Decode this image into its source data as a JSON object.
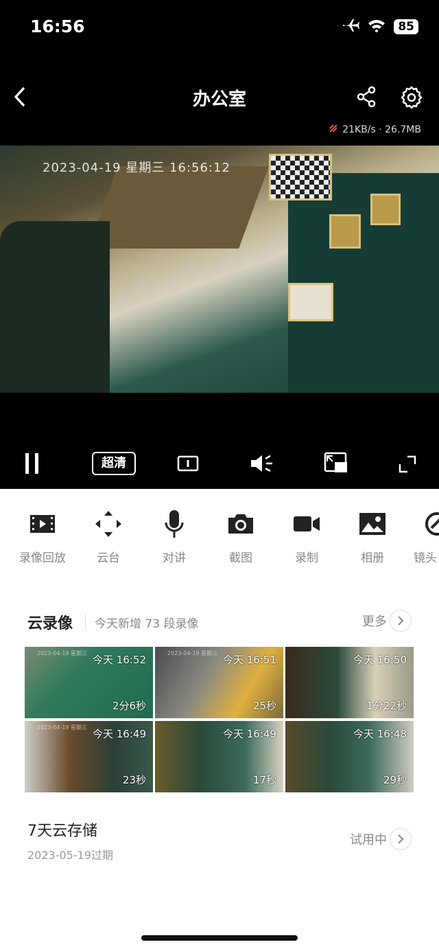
{
  "status": {
    "time": "16:56",
    "battery": "85"
  },
  "nav": {
    "title": "办公室"
  },
  "stream": {
    "speed": "21KB/s · 26.7MB"
  },
  "video": {
    "timestamp": "2023-04-19 星期三 16:56:12"
  },
  "controls": {
    "quality": "超清"
  },
  "toolbar": {
    "items": [
      {
        "label": "录像回放",
        "icon": "film-icon"
      },
      {
        "label": "云台",
        "icon": "ptz-arrows-icon"
      },
      {
        "label": "对讲",
        "icon": "microphone-icon"
      },
      {
        "label": "截图",
        "icon": "camera-icon"
      },
      {
        "label": "录制",
        "icon": "video-record-icon"
      },
      {
        "label": "相册",
        "icon": "album-icon"
      },
      {
        "label": "镜头",
        "icon": "lens-icon"
      }
    ]
  },
  "cloud": {
    "title": "云录像",
    "subtitle": "今天新增 73 段录像",
    "more": "更多",
    "clips": [
      {
        "time": "今天 16:52",
        "duration": "2分6秒",
        "watermark": "2023-04-19 星期三"
      },
      {
        "time": "今天 16:51",
        "duration": "25秒",
        "watermark": "2023-04-19 星期三"
      },
      {
        "time": "今天 16:50",
        "duration": "1分22秒",
        "watermark": ""
      },
      {
        "time": "今天 16:49",
        "duration": "23秒",
        "watermark": "2023-04-19 星期三"
      },
      {
        "time": "今天 16:49",
        "duration": "17秒",
        "watermark": ""
      },
      {
        "time": "今天 16:48",
        "duration": "29秒",
        "watermark": ""
      }
    ]
  },
  "storage": {
    "title": "7天云存储",
    "expiry": "2023-05-19过期",
    "status": "试用中"
  }
}
